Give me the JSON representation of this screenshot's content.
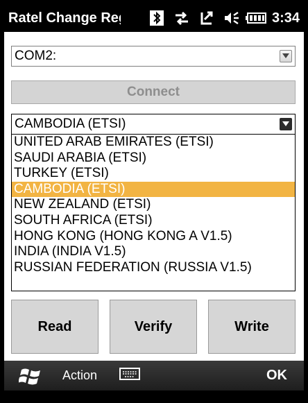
{
  "titlebar": {
    "title": "Ratel Change Regi",
    "time": "3:34",
    "icons": [
      "bluetooth-icon",
      "connectivity-icon",
      "sync-icon",
      "volume-icon",
      "battery-icon"
    ]
  },
  "port_combo": {
    "value": "COM2:"
  },
  "connect_button": {
    "label": "Connect"
  },
  "region_combo": {
    "value": "CAMBODIA (ETSI)"
  },
  "region_list": {
    "items": [
      "UNITED ARAB EMIRATES (ETSI)",
      "SAUDI ARABIA (ETSI)",
      "TURKEY (ETSI)",
      "CAMBODIA (ETSI)",
      "NEW ZEALAND (ETSI)",
      "SOUTH AFRICA (ETSI)",
      "HONG KONG (HONG KONG A V1.5)",
      "INDIA (INDIA V1.5)",
      "RUSSIAN FEDERATION (RUSSIA V1.5)"
    ],
    "selected_index": 3
  },
  "buttons": {
    "read": "Read",
    "verify": "Verify",
    "write": "Write"
  },
  "softkeys": {
    "left": "Action",
    "right": "OK"
  },
  "colors": {
    "selection": "#f2b443",
    "titlebar": "#000000"
  }
}
